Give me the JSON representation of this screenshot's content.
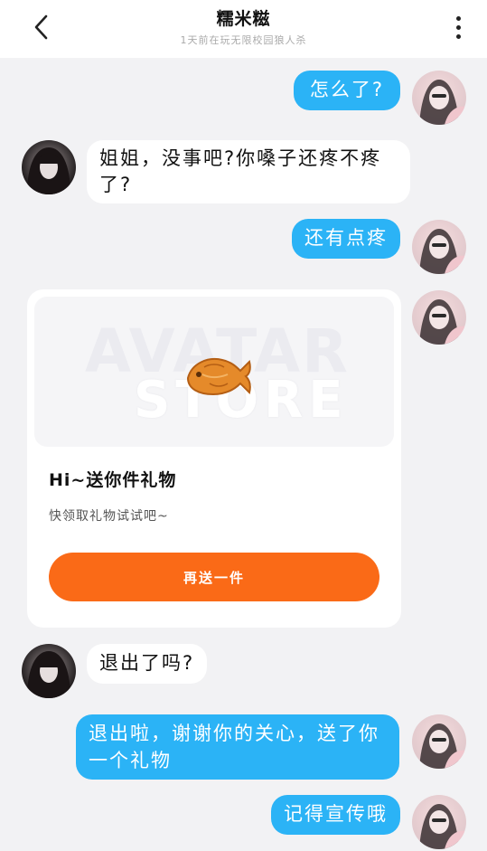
{
  "header": {
    "title": "糯米糍",
    "subtitle": "1天前在玩无限校园狼人杀"
  },
  "messages": {
    "m1": "怎么了?",
    "m2": "姐姐，没事吧?你嗓子还疼不疼了?",
    "m3": "还有点疼",
    "m4": "退出了吗?",
    "m5": "退出啦，谢谢你的关心，送了你一个礼物",
    "m6": "记得宣传哦"
  },
  "gift_card": {
    "title": "Hi~送你件礼物",
    "description": "快领取礼物试试吧~",
    "button_label": "再送一件",
    "watermark_top": "AVATAR",
    "watermark_bottom": "STORE"
  },
  "colors": {
    "my_bubble": "#2bb3f6",
    "their_bubble": "#ffffff",
    "gift_button": "#fa6a17",
    "background": "#f2f2f4"
  },
  "icons": [
    "back-arrow-icon",
    "more-vertical-icon",
    "fish-cookie-icon"
  ]
}
